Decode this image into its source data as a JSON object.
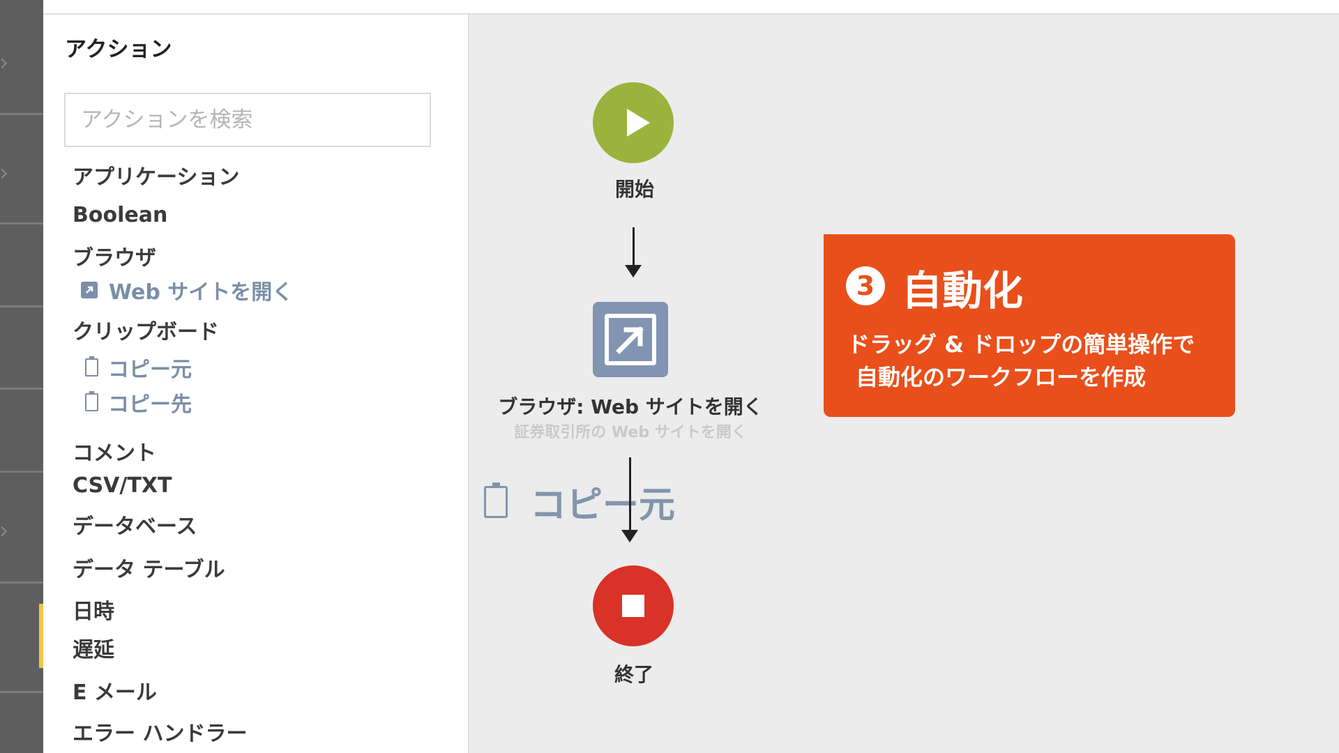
{
  "panel": {
    "title": "アクション",
    "search_placeholder": "アクションを検索",
    "categories": {
      "application": "アプリケーション",
      "boolean": "Boolean",
      "browser": "ブラウザ",
      "browser_open_site": "Web サイトを開く",
      "clipboard": "クリップボード",
      "clipboard_copy_from": "コピー元",
      "clipboard_copy_to": "コピー先",
      "comment": "コメント",
      "csv_txt": "CSV/TXT",
      "database": "データベース",
      "data_table": "データ テーブル",
      "datetime": "日時",
      "delay": "遅延",
      "email": "E メール",
      "error_handler": "エラー ハンドラー"
    }
  },
  "flow": {
    "start_label": "開始",
    "browser_title": "ブラウザ: Web サイトを開く",
    "browser_subtitle": "証券取引所の Web サイトを開く",
    "end_label": "終了",
    "drag_ghost_label": "コピー元"
  },
  "callout": {
    "number": "3",
    "title": "自動化",
    "desc_line1": "ドラッグ & ドロップの簡単操作で",
    "desc_line2": "自動化のワークフローを作成"
  },
  "colors": {
    "start": "#9bb23c",
    "end": "#d93228",
    "browser_node": "#8195b2",
    "callout": "#e94f1b",
    "sub_item": "#7b8ea8",
    "rail_accent": "#f2c744"
  },
  "icons": {
    "start": "play-icon",
    "end": "stop-icon",
    "browser": "open-external-icon",
    "clipboard": "clipboard-icon"
  }
}
